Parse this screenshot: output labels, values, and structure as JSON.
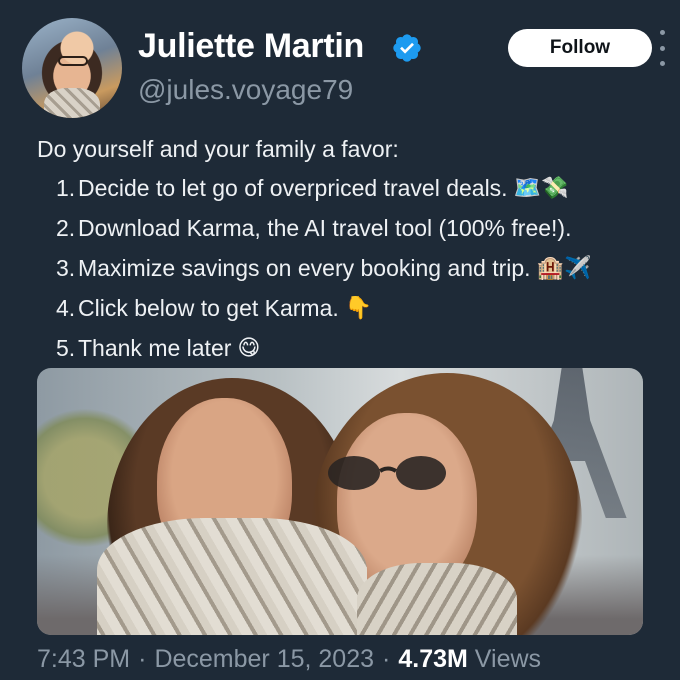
{
  "header": {
    "name": "Juliette Martin",
    "handle": "@jules.voyage79",
    "follow_label": "Follow"
  },
  "post": {
    "intro": "Do yourself and your family a favor:",
    "items": [
      {
        "num": "1.",
        "text": "Decide to let go of overpriced travel deals.",
        "emoji": "🗺️💸"
      },
      {
        "num": "2.",
        "text": "Download Karma, the AI travel tool (100% free!).",
        "emoji": ""
      },
      {
        "num": "3.",
        "text": "Maximize savings on every booking and trip.",
        "emoji": "🏨✈️"
      },
      {
        "num": "4.",
        "text": "Click below to get Karma.",
        "emoji": "👇"
      },
      {
        "num": "5.",
        "text": "Thank me later",
        "emoji": "😋"
      }
    ]
  },
  "meta": {
    "time": "7:43 PM",
    "date": "December 15, 2023",
    "separator": "·",
    "views_count": "4.73M",
    "views_label": "Views"
  },
  "colors": {
    "background": "#1e2a37",
    "secondary_text": "#8b98a5",
    "verified": "#1d9bf0"
  },
  "icons": {
    "verified": "verified-badge-icon",
    "more": "more-vertical-icon"
  }
}
